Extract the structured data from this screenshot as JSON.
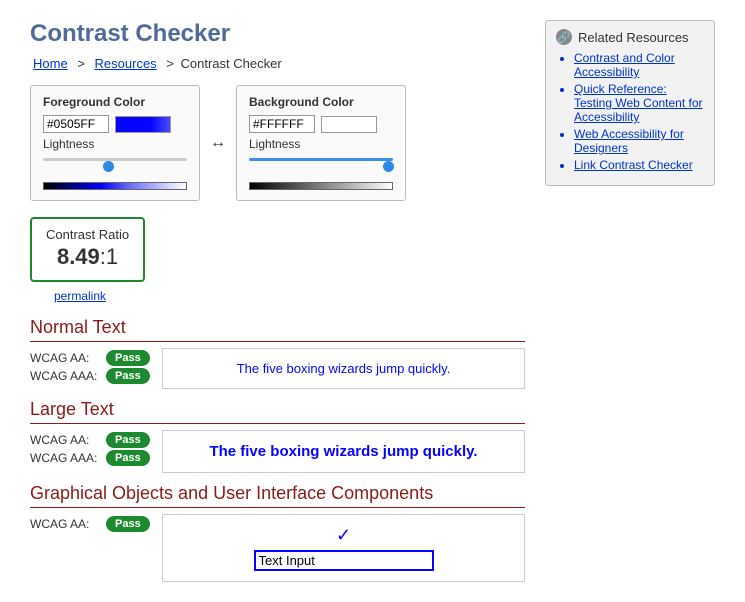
{
  "page_title": "Contrast Checker",
  "breadcrumb": {
    "home": "Home",
    "resources": "Resources",
    "current": "Contrast Checker"
  },
  "foreground": {
    "title": "Foreground Color",
    "hex": "#0505FF",
    "lightness_label": "Lightness"
  },
  "background": {
    "title": "Background Color",
    "hex": "#FFFFFF",
    "lightness_label": "Lightness"
  },
  "ratio": {
    "title": "Contrast Ratio",
    "value": "8.49",
    "suffix": ":1",
    "permalink": "permalink"
  },
  "sections": {
    "normal": "Normal Text",
    "large": "Large Text",
    "ui": "Graphical Objects and User Interface Components"
  },
  "labels": {
    "aa": "WCAG AA:",
    "aaa": "WCAG AAA:",
    "pass": "Pass"
  },
  "sample_text": "The five boxing wizards jump quickly.",
  "demo_input_value": "Text Input",
  "related": {
    "header": "Related Resources",
    "items": [
      "Contrast and Color Accessibility",
      "Quick Reference: Testing Web Content for Accessibility",
      "Web Accessibility for Designers",
      "Link Contrast Checker"
    ]
  }
}
